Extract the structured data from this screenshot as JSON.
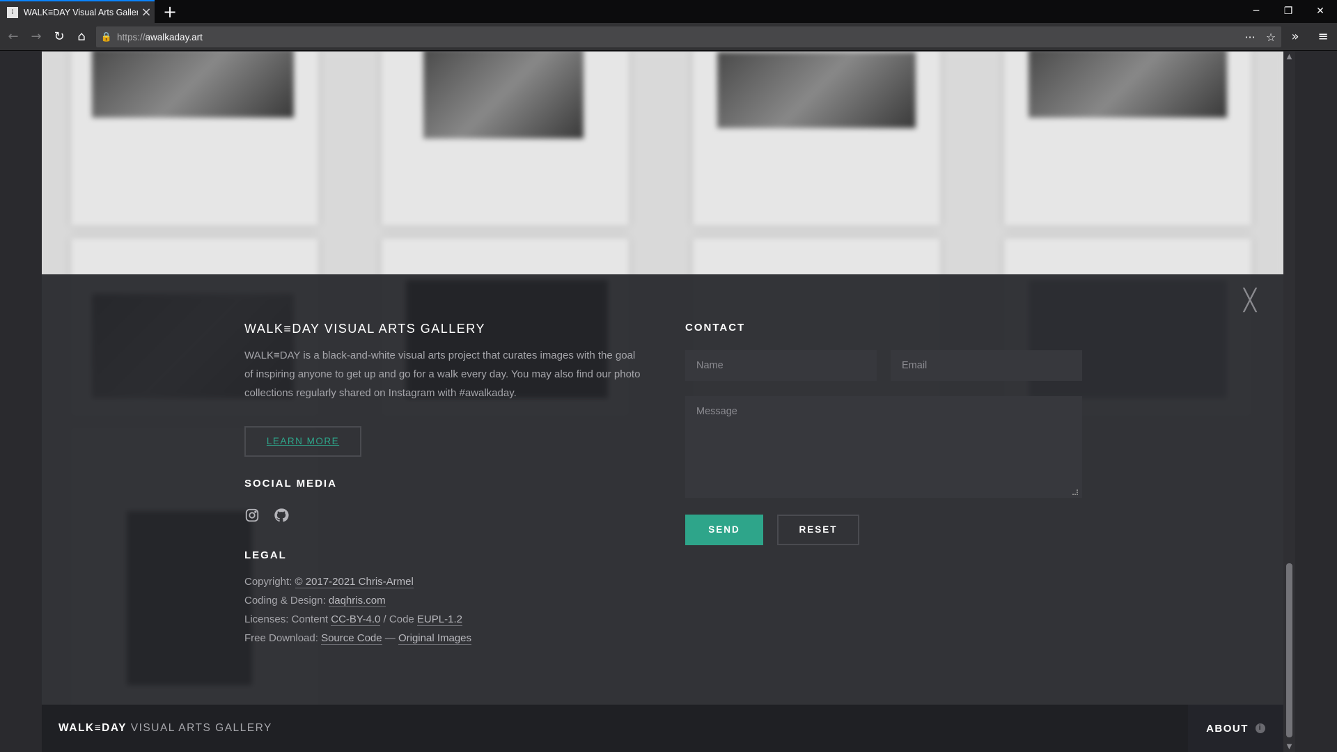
{
  "browser": {
    "tab_title": "WALK≡DAY Visual Arts Gallery",
    "url_scheme": "https://",
    "url_host": "awalkaday.art"
  },
  "about_panel": {
    "heading": "WALK≡DAY VISUAL ARTS GALLERY",
    "description": "WALK≡DAY is a black-and-white visual arts project that curates images with the goal of inspiring anyone to get up and go for a walk every day. You may also find our photo collections regularly shared on Instagram with #awalkaday.",
    "learn_more_label": "LEARN MORE",
    "social_heading": "SOCIAL MEDIA",
    "social_icons": [
      "instagram-icon",
      "github-icon"
    ],
    "legal_heading": "LEGAL",
    "legal": {
      "copyright_prefix": "Copyright: ",
      "copyright_link": "© 2017-2021 Chris-Armel",
      "coding_prefix": "Coding & Design: ",
      "coding_link": "daqhris.com",
      "licenses_prefix": "Licenses: Content ",
      "licenses_content_link": "CC-BY-4.0",
      "licenses_mid": " / Code ",
      "licenses_code_link": "EUPL-1.2",
      "download_prefix": "Free Download: ",
      "download_source_link": "Source Code",
      "download_sep": " — ",
      "download_images_link": "Original Images"
    }
  },
  "contact": {
    "heading": "CONTACT",
    "name_placeholder": "Name",
    "email_placeholder": "Email",
    "message_placeholder": "Message",
    "send_label": "SEND",
    "reset_label": "RESET"
  },
  "footer": {
    "brand_strong": "WALK≡DAY",
    "brand_rest": " VISUAL ARTS GALLERY",
    "about_label": "ABOUT"
  },
  "colors": {
    "accent": "#2ea58a",
    "panel_bg": "#242529",
    "footer_bg": "#1f2024"
  }
}
